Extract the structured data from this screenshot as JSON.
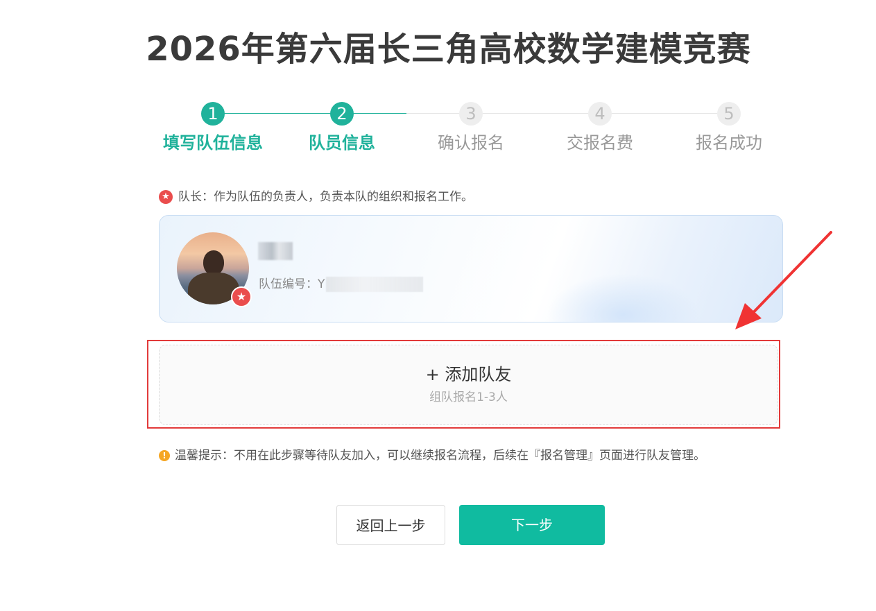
{
  "page": {
    "title": "2026年第六届长三角高校数学建模竞赛"
  },
  "steps": [
    {
      "number": "1",
      "label": "填写队伍信息",
      "state": "active"
    },
    {
      "number": "2",
      "label": "队员信息",
      "state": "active"
    },
    {
      "number": "3",
      "label": "确认报名",
      "state": "todo"
    },
    {
      "number": "4",
      "label": "交报名费",
      "state": "todo"
    },
    {
      "number": "5",
      "label": "报名成功",
      "state": "todo"
    }
  ],
  "captain": {
    "note_icon": "star-badge-icon",
    "note": "队长：作为队伍的负责人，负责本队的组织和报名工作。",
    "name": "",
    "team_id_label": "队伍编号：",
    "team_id_value": "Y"
  },
  "add_teammate": {
    "label": "+ 添加队友",
    "sub": "组队报名1-3人"
  },
  "tip": {
    "icon": "warning-icon",
    "text": "温馨提示：不用在此步骤等待队友加入，可以继续报名流程，后续在『报名管理』页面进行队友管理。"
  },
  "buttons": {
    "back": "返回上一步",
    "next": "下一步"
  },
  "colors": {
    "accent": "#20b29b",
    "primary_button": "#10bba0",
    "captain_badge": "#ea4d4d",
    "highlight": "#e23a3a",
    "warning": "#f5a623"
  }
}
